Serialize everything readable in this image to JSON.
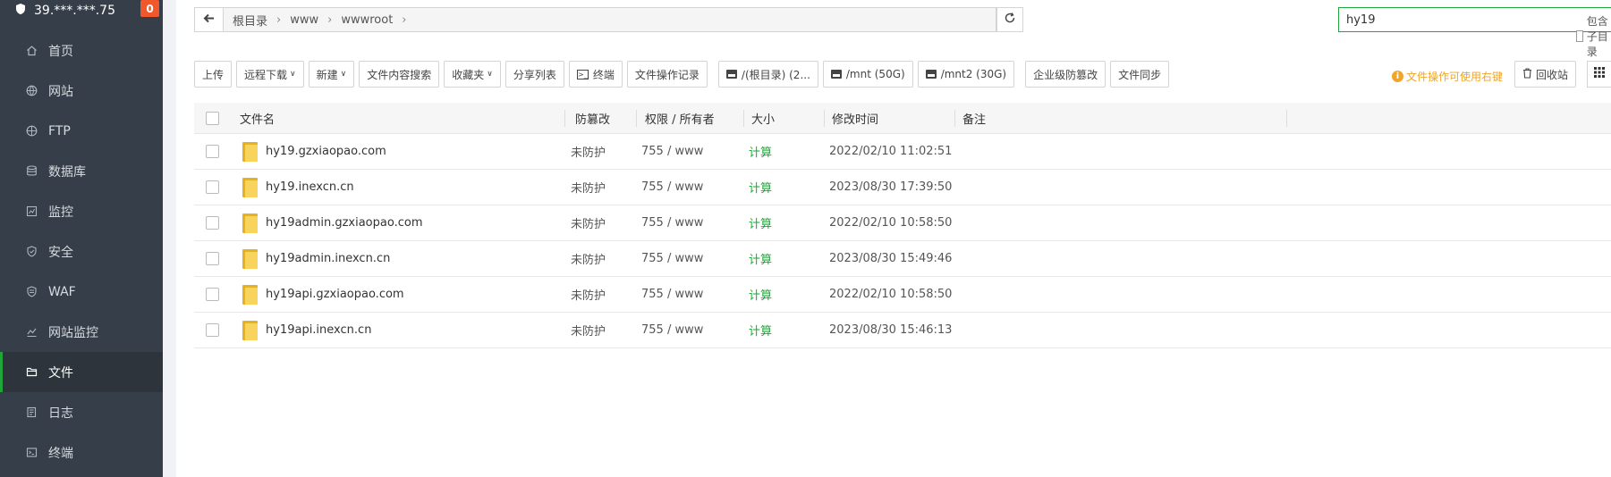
{
  "sidebar": {
    "server_ip": "39.***.***.75",
    "badge": "0",
    "items": [
      {
        "label": "首页",
        "icon": "home-icon"
      },
      {
        "label": "网站",
        "icon": "globe-icon"
      },
      {
        "label": "FTP",
        "icon": "ftp-globe-icon"
      },
      {
        "label": "数据库",
        "icon": "database-icon"
      },
      {
        "label": "监控",
        "icon": "monitor-icon"
      },
      {
        "label": "安全",
        "icon": "shield-icon"
      },
      {
        "label": "WAF",
        "icon": "waf-shield-icon"
      },
      {
        "label": "网站监控",
        "icon": "chart-icon"
      },
      {
        "label": "文件",
        "icon": "folder-icon",
        "active": true
      },
      {
        "label": "日志",
        "icon": "log-icon"
      },
      {
        "label": "终端",
        "icon": "terminal-icon"
      }
    ]
  },
  "address": {
    "crumbs": [
      "根目录",
      "www",
      "wwwroot"
    ]
  },
  "search": {
    "value": "hy19",
    "include_sub_label": "包含子目录"
  },
  "toolbar": {
    "upload": "上传",
    "remote_download": "远程下载",
    "new": "新建",
    "content_search": "文件内容搜索",
    "favorites": "收藏夹",
    "share_list": "分享列表",
    "terminal": "终端",
    "op_log": "文件操作记录",
    "disk_root": "/(根目录) (2...",
    "disk_mnt": "/mnt (50G)",
    "disk_mnt2": "/mnt2 (30G)",
    "tamper": "企业级防篡改",
    "sync": "文件同步",
    "tip": "文件操作可使用右键",
    "recycle": "回收站"
  },
  "table": {
    "headers": {
      "name": "文件名",
      "protect": "防篡改",
      "perm": "权限 / 所有者",
      "size": "大小",
      "mtime": "修改时间",
      "note": "备注"
    },
    "rows": [
      {
        "name": "hy19.gzxiaopao.com",
        "protect": "未防护",
        "perm": "755 / www",
        "size": "计算",
        "mtime": "2022/02/10 11:02:51"
      },
      {
        "name": "hy19.inexcn.cn",
        "protect": "未防护",
        "perm": "755 / www",
        "size": "计算",
        "mtime": "2023/08/30 17:39:50"
      },
      {
        "name": "hy19admin.gzxiaopao.com",
        "protect": "未防护",
        "perm": "755 / www",
        "size": "计算",
        "mtime": "2022/02/10 10:58:50"
      },
      {
        "name": "hy19admin.inexcn.cn",
        "protect": "未防护",
        "perm": "755 / www",
        "size": "计算",
        "mtime": "2023/08/30 15:49:46"
      },
      {
        "name": "hy19api.gzxiaopao.com",
        "protect": "未防护",
        "perm": "755 / www",
        "size": "计算",
        "mtime": "2022/02/10 10:58:50"
      },
      {
        "name": "hy19api.inexcn.cn",
        "protect": "未防护",
        "perm": "755 / www",
        "size": "计算",
        "mtime": "2023/08/30 15:46:13"
      }
    ]
  }
}
